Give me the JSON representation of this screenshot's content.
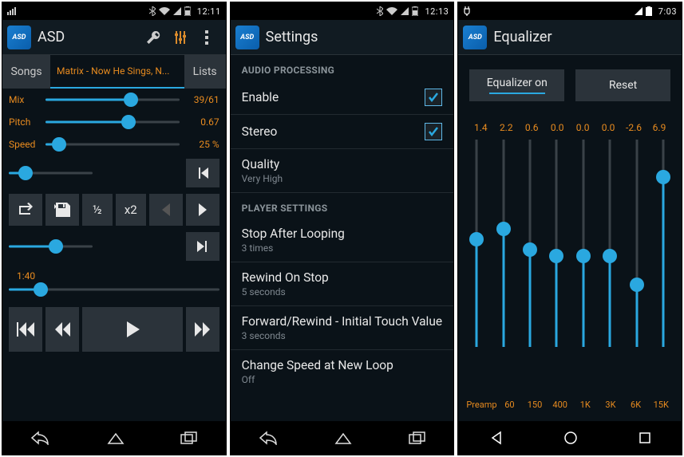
{
  "panels": {
    "player": {
      "status_time": "12:11",
      "app_title": "ASD",
      "tabs": {
        "songs": "Songs",
        "lists": "Lists"
      },
      "now_playing": "Matrix - Now He Sings, N...",
      "mix": {
        "label": "Mix",
        "value": "39/61",
        "pct": 64
      },
      "pitch": {
        "label": "Pitch",
        "value": "0.67",
        "pct": 62
      },
      "speed": {
        "label": "Speed",
        "value": "25 %",
        "pct": 10
      },
      "extra_slider": {
        "pct": 20
      },
      "half_label": "½",
      "x2_label": "x2",
      "progress": {
        "pct": 56
      },
      "position_time": "1:40",
      "seek": {
        "pct": 15
      }
    },
    "settings": {
      "status_time": "12:13",
      "title": "Settings",
      "audio_header": "AUDIO PROCESSING",
      "enable": {
        "label": "Enable",
        "checked": true
      },
      "stereo": {
        "label": "Stereo",
        "checked": true
      },
      "quality": {
        "label": "Quality",
        "sub": "Very High"
      },
      "player_header": "PLAYER SETTINGS",
      "stop_loop": {
        "label": "Stop After Looping",
        "sub": "3 times"
      },
      "rewind_stop": {
        "label": "Rewind On Stop",
        "sub": "5 seconds"
      },
      "ff_rw": {
        "label": "Forward/Rewind - Initial Touch Value",
        "sub": "3 seconds"
      },
      "change_speed": {
        "label": "Change Speed at New Loop",
        "sub": "Off"
      }
    },
    "equalizer": {
      "status_time": "7:03",
      "title": "Equalizer",
      "toggle_on": "Equalizer on",
      "reset": "Reset",
      "bands": [
        {
          "label": "Preamp",
          "value": "1.4",
          "pct": 52
        },
        {
          "label": "60",
          "value": "2.2",
          "pct": 57
        },
        {
          "label": "150",
          "value": "0.6",
          "pct": 47
        },
        {
          "label": "400",
          "value": "0.0",
          "pct": 44
        },
        {
          "label": "1K",
          "value": "0.0",
          "pct": 44
        },
        {
          "label": "3K",
          "value": "0.0",
          "pct": 44
        },
        {
          "label": "6K",
          "value": "-2.6",
          "pct": 30
        },
        {
          "label": "15K",
          "value": "6.9",
          "pct": 82
        }
      ]
    }
  }
}
